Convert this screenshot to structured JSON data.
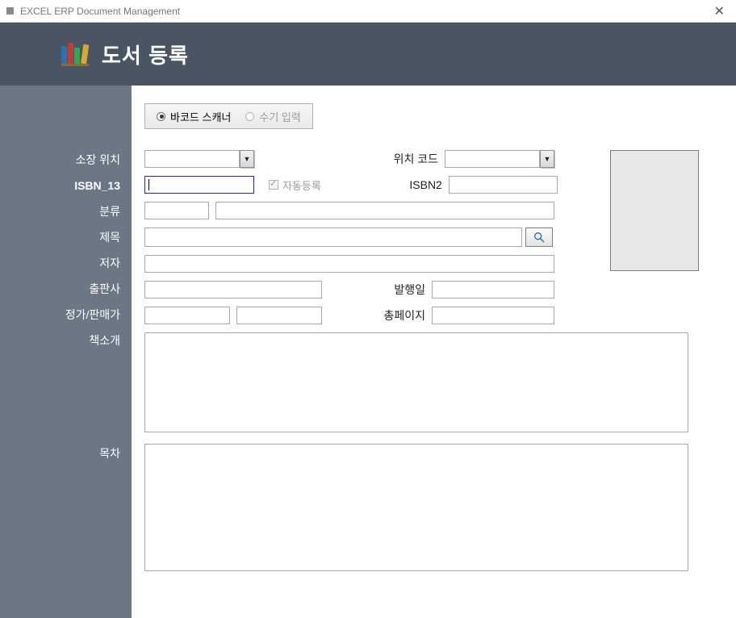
{
  "window": {
    "title": "EXCEL ERP Document Management"
  },
  "header": {
    "title": "도서 등록"
  },
  "mode": {
    "barcode": "바코드 스캐너",
    "manual": "수기 입력"
  },
  "labels": {
    "location": "소장 위치",
    "isbn13": "ISBN_13",
    "category": "분류",
    "title": "제목",
    "author": "저자",
    "publisher": "출판사",
    "price": "정가/판매가",
    "intro": "책소개",
    "toc": "목차",
    "location_code": "위치 코드",
    "isbn2": "ISBN2",
    "auto_register": "자동등록",
    "pubdate": "발행일",
    "pages": "총페이지"
  },
  "fields": {
    "location": "",
    "location_code": "",
    "isbn13": "",
    "isbn2": "",
    "category_code": "",
    "category_name": "",
    "title": "",
    "author": "",
    "publisher": "",
    "pubdate": "",
    "list_price": "",
    "sale_price": "",
    "pages": "",
    "intro": "",
    "toc": ""
  }
}
